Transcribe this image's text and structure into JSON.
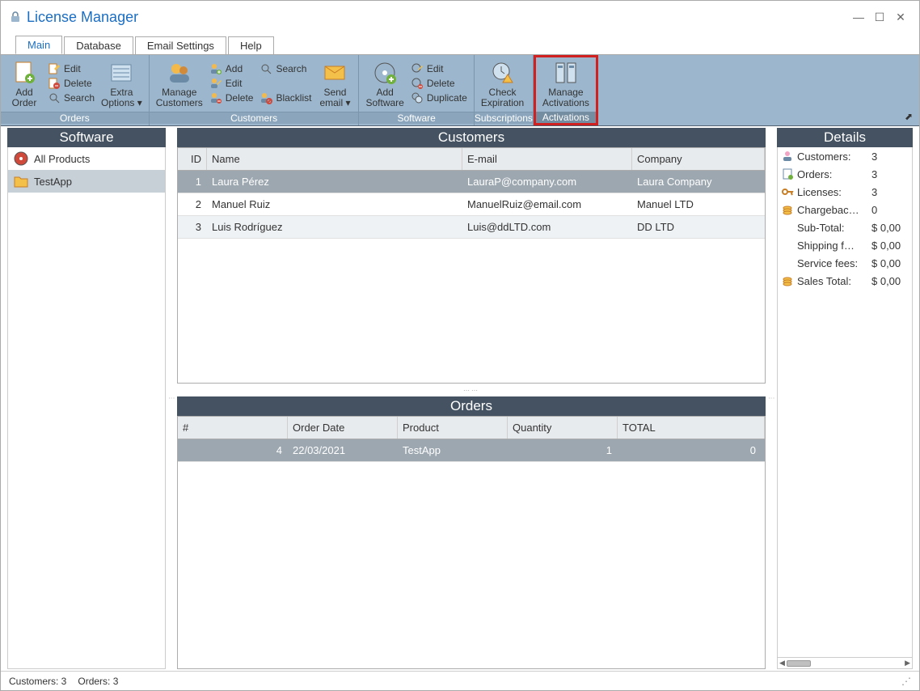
{
  "app": {
    "title": "License Manager"
  },
  "tabs": [
    "Main",
    "Database",
    "Email Settings",
    "Help"
  ],
  "ribbon": {
    "orders": {
      "label": "Orders",
      "add": "Add\nOrder",
      "extra": "Extra\nOptions",
      "edit": "Edit",
      "delete": "Delete",
      "search": "Search"
    },
    "customers": {
      "label": "Customers",
      "manage": "Manage\nCustomers",
      "add": "Add",
      "edit": "Edit",
      "delete": "Delete",
      "search": "Search",
      "blacklist": "Blacklist",
      "send": "Send\nemail"
    },
    "software": {
      "label": "Software",
      "add": "Add\nSoftware",
      "edit": "Edit",
      "delete": "Delete",
      "duplicate": "Duplicate"
    },
    "subscriptions": {
      "label": "Subscriptions",
      "check": "Check\nExpiration"
    },
    "activations": {
      "label": "Activations",
      "manage": "Manage\nActivations"
    }
  },
  "sidebar": {
    "title": "Software",
    "items": [
      {
        "label": "All Products",
        "icon": "disc",
        "selected": false
      },
      {
        "label": "TestApp",
        "icon": "folder",
        "selected": true
      }
    ]
  },
  "customers": {
    "title": "Customers",
    "cols": {
      "id": "ID",
      "name": "Name",
      "email": "E-mail",
      "company": "Company"
    },
    "rows": [
      {
        "id": "1",
        "name": "Laura Pérez",
        "email": "LauraP@company.com",
        "company": "Laura Company",
        "sel": true
      },
      {
        "id": "2",
        "name": "Manuel Ruiz",
        "email": "ManuelRuiz@email.com",
        "company": "Manuel LTD",
        "sel": false
      },
      {
        "id": "3",
        "name": "Luis Rodríguez",
        "email": "Luis@ddLTD.com",
        "company": "DD LTD",
        "sel": false
      }
    ]
  },
  "orders": {
    "title": "Orders",
    "cols": {
      "num": "#",
      "date": "Order Date",
      "product": "Product",
      "qty": "Quantity",
      "total": "TOTAL"
    },
    "rows": [
      {
        "num": "4",
        "date": "22/03/2021",
        "product": "TestApp",
        "qty": "1",
        "total": "0",
        "sel": true
      }
    ]
  },
  "details": {
    "title": "Details",
    "rows": [
      {
        "k": "Customers:",
        "v": "3",
        "icon": "user"
      },
      {
        "k": "Orders:",
        "v": "3",
        "icon": "doc"
      },
      {
        "k": "Licenses:",
        "v": "3",
        "icon": "key"
      },
      {
        "k": "Chargebac…",
        "v": "0",
        "icon": "coins"
      },
      {
        "k": "Sub-Total:",
        "v": "$ 0,00",
        "icon": ""
      },
      {
        "k": "Shipping f…",
        "v": "$ 0,00",
        "icon": ""
      },
      {
        "k": "Service fees:",
        "v": "$ 0,00",
        "icon": ""
      },
      {
        "k": "Sales Total:",
        "v": "$ 0,00",
        "icon": "coins"
      }
    ]
  },
  "status": {
    "customers": "Customers: 3",
    "orders": "Orders: 3"
  }
}
